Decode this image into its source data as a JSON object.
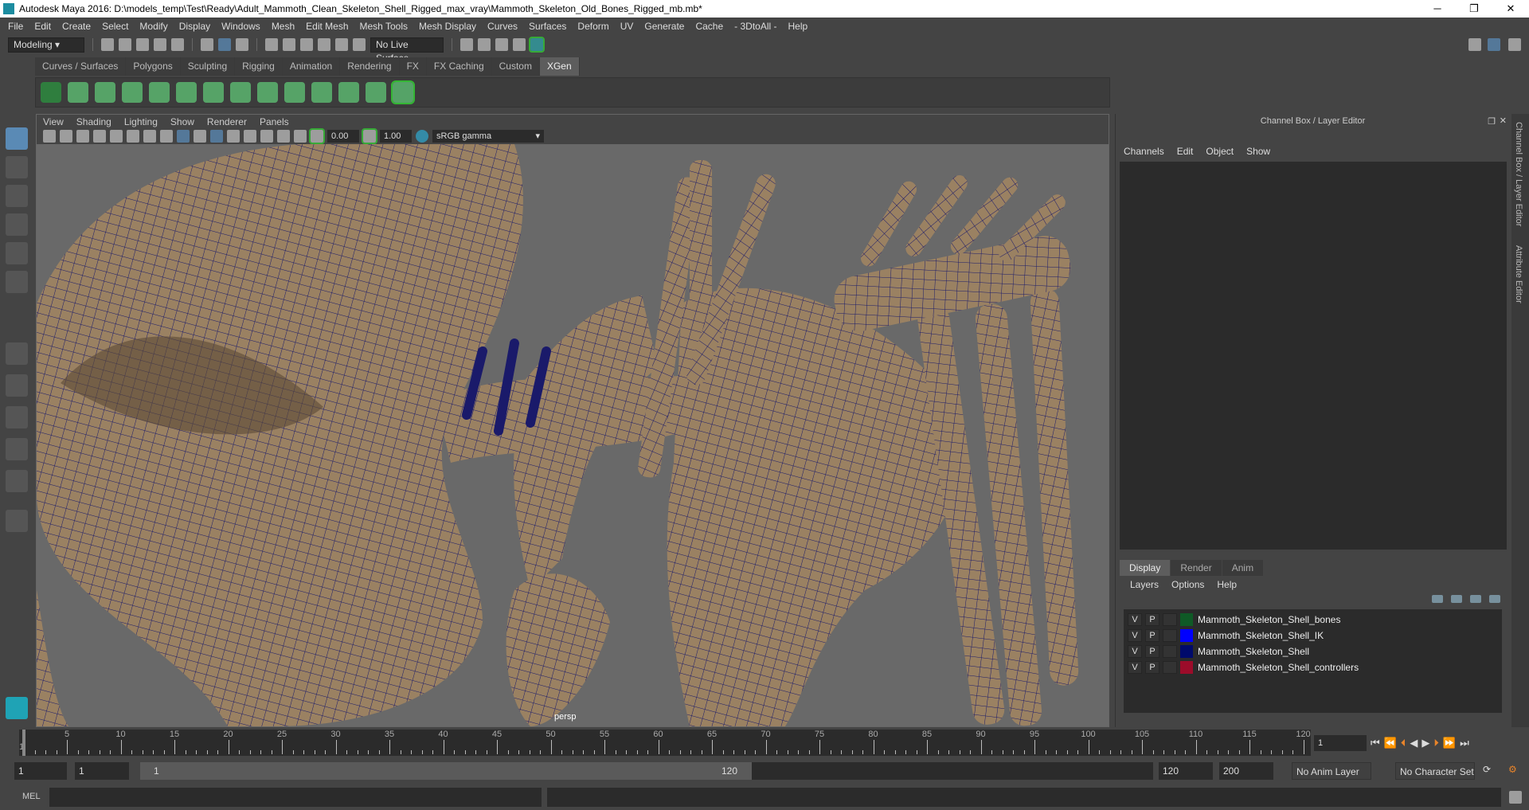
{
  "window": {
    "title": "Autodesk Maya 2016: D:\\models_temp\\Test\\Ready\\Adult_Mammoth_Clean_Skeleton_Shell_Rigged_max_vray\\Mammoth_Skeleton_Old_Bones_Rigged_mb.mb*",
    "minimize": "─",
    "maximize": "❐",
    "close": "✕"
  },
  "menu": [
    "File",
    "Edit",
    "Create",
    "Select",
    "Modify",
    "Display",
    "Windows",
    "Mesh",
    "Edit Mesh",
    "Mesh Tools",
    "Mesh Display",
    "Curves",
    "Surfaces",
    "Deform",
    "UV",
    "Generate",
    "Cache",
    "- 3DtoAll -",
    "Help"
  ],
  "toolbar": {
    "mode": "Modeling",
    "live_surface": "No Live Surface"
  },
  "shelf_tabs": [
    "Curves / Surfaces",
    "Polygons",
    "Sculpting",
    "Rigging",
    "Animation",
    "Rendering",
    "FX",
    "FX Caching",
    "Custom",
    "XGen"
  ],
  "shelf_active": "XGen",
  "viewport": {
    "menu": [
      "View",
      "Shading",
      "Lighting",
      "Show",
      "Renderer",
      "Panels"
    ],
    "exposure": "0.00",
    "gamma": "1.00",
    "color_space": "sRGB gamma",
    "camera": "persp"
  },
  "channel_box": {
    "title": "Channel Box / Layer Editor",
    "menu": [
      "Channels",
      "Edit",
      "Object",
      "Show"
    ]
  },
  "layer_editor": {
    "tabs": [
      "Display",
      "Render",
      "Anim"
    ],
    "active_tab": "Display",
    "menu": [
      "Layers",
      "Options",
      "Help"
    ],
    "layers": [
      {
        "v": "V",
        "p": "P",
        "name": "Mammoth_Skeleton_Shell_bones",
        "color": "#0f5a26"
      },
      {
        "v": "V",
        "p": "P",
        "name": "Mammoth_Skeleton_Shell_IK",
        "color": "#0000ff"
      },
      {
        "v": "V",
        "p": "P",
        "name": "Mammoth_Skeleton_Shell",
        "color": "#000a6b"
      },
      {
        "v": "V",
        "p": "P",
        "name": "Mammoth_Skeleton_Shell_controllers",
        "color": "#9c0c2a"
      }
    ]
  },
  "side_tabs": [
    "Channel Box / Layer Editor",
    "Attribute Editor"
  ],
  "timeline": {
    "start": 1,
    "end": 120,
    "labels": [
      5,
      10,
      15,
      20,
      25,
      30,
      35,
      40,
      45,
      50,
      55,
      60,
      65,
      70,
      75,
      80,
      85,
      90,
      95,
      100,
      105,
      110,
      115,
      120
    ],
    "current_frame": "1",
    "first_label": "1"
  },
  "range": {
    "start": "1",
    "playback_start": "1",
    "slider_start": "1",
    "slider_end": "120",
    "playback_end": "120",
    "end": "200",
    "anim_layer": "No Anim Layer",
    "character_set": "No Character Set"
  },
  "mel": {
    "label": "MEL"
  }
}
